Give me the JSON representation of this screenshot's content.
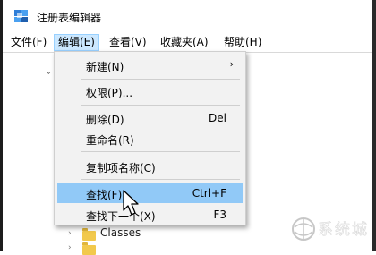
{
  "window": {
    "title": "注册表编辑器"
  },
  "menubar": [
    {
      "label": "文件(F)"
    },
    {
      "label": "编辑(E)"
    },
    {
      "label": "查看(V)"
    },
    {
      "label": "收藏夹(A)"
    },
    {
      "label": "帮助(H)"
    }
  ],
  "edit_menu": {
    "items": [
      {
        "label": "新建(N)",
        "submenu": true
      },
      {
        "label": "权限(P)..."
      },
      {
        "label": "删除(D)",
        "shortcut": "Del"
      },
      {
        "label": "重命名(R)"
      },
      {
        "label": "复制项名称(C)"
      },
      {
        "label": "查找(F)...",
        "shortcut": "Ctrl+F",
        "highlighted": true
      },
      {
        "label": "查找下一个(X)",
        "shortcut": "F3"
      }
    ]
  },
  "tree": {
    "visible_rows": [
      {
        "label": "Classes"
      }
    ]
  },
  "watermark": {
    "text": "系统城"
  }
}
